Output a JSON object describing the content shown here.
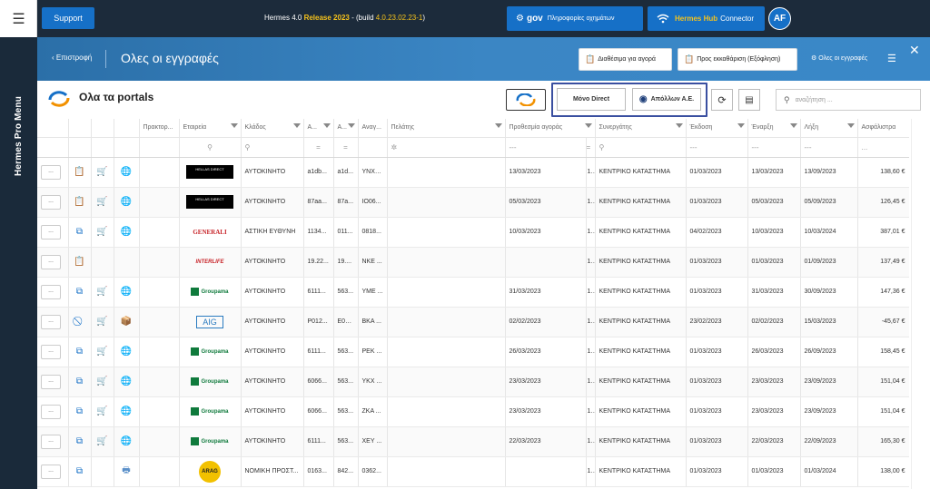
{
  "rail": {
    "menu_label": "Hermes Pro Menu"
  },
  "topbar": {
    "support_label": "Support",
    "version_prefix": "Hermes 4.0 ",
    "version_release": "Release 2023",
    "version_mid": " - (build ",
    "version_build": "4.0.23.02.23-1",
    "version_suffix": ")",
    "govgr_label": "gov",
    "govgr_text": "Πληροφορίες οχημάτων",
    "hub_bold": "Hermes Hub",
    "hub_text": "Connector",
    "avatar": "AF"
  },
  "header": {
    "back_label": "Επιστροφή",
    "title": "Ολες οι εγγραφές",
    "btn_available": "Διαθέσιμα για αγορά",
    "btn_clearance": "Προς εκκαθάριση (Εξόφληση)",
    "all_records": "Ολες οι εγγραφές"
  },
  "toolbar": {
    "portals_title": "Ολα τα portals",
    "direct_only": "Μόνο Direct",
    "apollon": "Απόλλων Α.Ε.",
    "search_placeholder": "αναζήτηση ..."
  },
  "columns": {
    "praktor": "Πρακτορ...",
    "company": "Εταιρεία",
    "branch": "Κλάδος",
    "a1": "Α...",
    "a2": "Α...",
    "anag": "Αναγ...",
    "client": "Πελάτης",
    "deadline": "Προθεσμία αγοράς",
    "partner": "Συνεργάτης",
    "issue": "Έκδοση",
    "start": "Έναρξη",
    "end": "Λήξη",
    "premium": "Ασφάλιστρα"
  },
  "filters": {
    "dash": "---",
    "eq": "=",
    "dots": "..."
  },
  "rows": [
    {
      "menu": "...",
      "icons": [
        "clip",
        "cart",
        "globe"
      ],
      "logo": "hellas",
      "logo_text": "HELLAS DIRECT",
      "branch": "ΑΥΤΟΚΙΝΗΤΟ",
      "a1": "a1db...",
      "a2": "a1d...",
      "anag": "YNX2...",
      "client": "",
      "deadline": "13/03/2023",
      "n": "1...",
      "partner": "ΚΕΝΤΡΙΚΟ ΚΑΤΑΣΤΗΜΑ",
      "issue": "01/03/2023",
      "start": "13/03/2023",
      "end": "13/09/2023",
      "premium": "138,60 €"
    },
    {
      "menu": "...",
      "icons": [
        "clip",
        "cart",
        "globe"
      ],
      "logo": "hellas",
      "logo_text": "HELLAS DIRECT",
      "branch": "ΑΥΤΟΚΙΝΗΤΟ",
      "a1": "87aa...",
      "a2": "87a...",
      "anag": "IO06...",
      "client": "",
      "deadline": "05/03/2023",
      "n": "1...",
      "partner": "ΚΕΝΤΡΙΚΟ ΚΑΤΑΣΤΗΜΑ",
      "issue": "01/03/2023",
      "start": "05/03/2023",
      "end": "05/09/2023",
      "premium": "126,45 €"
    },
    {
      "menu": "...",
      "icons": [
        "copy",
        "cart",
        "globe"
      ],
      "logo": "generali",
      "logo_text": "GENERALI",
      "branch": "ΑΣΤΙΚΗ ΕΥΘΥΝΗ",
      "a1": "1134...",
      "a2": "011...",
      "anag": "0818...",
      "client": "",
      "deadline": "10/03/2023",
      "n": "1...",
      "partner": "ΚΕΝΤΡΙΚΟ ΚΑΤΑΣΤΗΜΑ",
      "issue": "04/02/2023",
      "start": "10/03/2023",
      "end": "10/03/2024",
      "premium": "387,01 €"
    },
    {
      "menu": "...",
      "icons": [
        "clip",
        "",
        ""
      ],
      "logo": "interlife",
      "logo_text": "INTERLIFE",
      "branch": "ΑΥΤΟΚΙΝΗΤΟ",
      "a1": "19.22...",
      "a2": "19....",
      "anag": "NKE ...",
      "client": "",
      "deadline": "",
      "n": "1...",
      "partner": "ΚΕΝΤΡΙΚΟ ΚΑΤΑΣΤΗΜΑ",
      "issue": "01/03/2023",
      "start": "01/03/2023",
      "end": "01/09/2023",
      "premium": "137,49 €"
    },
    {
      "menu": "...",
      "icons": [
        "copy",
        "cart",
        "globe"
      ],
      "logo": "groupama",
      "logo_text": "Groupama",
      "branch": "ΑΥΤΟΚΙΝΗΤΟ",
      "a1": "6111...",
      "a2": "563...",
      "anag": "YME ...",
      "client": "",
      "deadline": "31/03/2023",
      "n": "1...",
      "partner": "ΚΕΝΤΡΙΚΟ ΚΑΤΑΣΤΗΜΑ",
      "issue": "01/03/2023",
      "start": "31/03/2023",
      "end": "30/09/2023",
      "premium": "147,36 €"
    },
    {
      "menu": "...",
      "icons": [
        "ban",
        "cartred",
        "box"
      ],
      "logo": "aig",
      "logo_text": "AIG",
      "branch": "ΑΥΤΟΚΙΝΗΤΟ",
      "a1": "P012...",
      "a2": "E01...",
      "anag": "BKA ...",
      "client": "",
      "deadline": "02/02/2023",
      "n": "1...",
      "partner": "ΚΕΝΤΡΙΚΟ ΚΑΤΑΣΤΗΜΑ",
      "issue": "23/02/2023",
      "start": "02/02/2023",
      "end": "15/03/2023",
      "premium": "-45,67 €"
    },
    {
      "menu": "...",
      "icons": [
        "copy",
        "cart",
        "globe"
      ],
      "logo": "groupama",
      "logo_text": "Groupama",
      "branch": "ΑΥΤΟΚΙΝΗΤΟ",
      "a1": "6111...",
      "a2": "563...",
      "anag": "PEK ...",
      "client": "",
      "deadline": "26/03/2023",
      "n": "1...",
      "partner": "ΚΕΝΤΡΙΚΟ ΚΑΤΑΣΤΗΜΑ",
      "issue": "01/03/2023",
      "start": "26/03/2023",
      "end": "26/09/2023",
      "premium": "158,45 €"
    },
    {
      "menu": "...",
      "icons": [
        "copy",
        "cart",
        "globe"
      ],
      "logo": "groupama",
      "logo_text": "Groupama",
      "branch": "ΑΥΤΟΚΙΝΗΤΟ",
      "a1": "6066...",
      "a2": "563...",
      "anag": "YKX ...",
      "client": "",
      "deadline": "23/03/2023",
      "n": "1...",
      "partner": "ΚΕΝΤΡΙΚΟ ΚΑΤΑΣΤΗΜΑ",
      "issue": "01/03/2023",
      "start": "23/03/2023",
      "end": "23/09/2023",
      "premium": "151,04 €"
    },
    {
      "menu": "...",
      "icons": [
        "copy",
        "cart",
        "globe"
      ],
      "logo": "groupama",
      "logo_text": "Groupama",
      "branch": "ΑΥΤΟΚΙΝΗΤΟ",
      "a1": "6066...",
      "a2": "563...",
      "anag": "ZKA ...",
      "client": "",
      "deadline": "23/03/2023",
      "n": "1...",
      "partner": "ΚΕΝΤΡΙΚΟ ΚΑΤΑΣΤΗΜΑ",
      "issue": "01/03/2023",
      "start": "23/03/2023",
      "end": "23/09/2023",
      "premium": "151,04 €"
    },
    {
      "menu": "...",
      "icons": [
        "copy",
        "cart",
        "globe"
      ],
      "logo": "groupama",
      "logo_text": "Groupama",
      "branch": "ΑΥΤΟΚΙΝΗΤΟ",
      "a1": "6111...",
      "a2": "563...",
      "anag": "XEY ...",
      "client": "",
      "deadline": "22/03/2023",
      "n": "1...",
      "partner": "ΚΕΝΤΡΙΚΟ ΚΑΤΑΣΤΗΜΑ",
      "issue": "01/03/2023",
      "start": "22/03/2023",
      "end": "22/09/2023",
      "premium": "165,30 €"
    },
    {
      "menu": "...",
      "icons": [
        "copy",
        "",
        "print"
      ],
      "logo": "arag",
      "logo_text": "ARAG",
      "branch": "ΝΟΜΙΚΗ ΠΡΟΣΤ...",
      "a1": "0163...",
      "a2": "842...",
      "anag": "0362...",
      "client": "",
      "deadline": "",
      "n": "1...",
      "partner": "ΚΕΝΤΡΙΚΟ ΚΑΤΑΣΤΗΜΑ",
      "issue": "01/03/2023",
      "start": "01/03/2023",
      "end": "01/03/2024",
      "premium": "138,00 €"
    }
  ],
  "colors": {
    "topbar": "#1c2b3b",
    "accent": "#1670c7",
    "highlight": "#f5c21b",
    "band": "#3b86c4"
  }
}
